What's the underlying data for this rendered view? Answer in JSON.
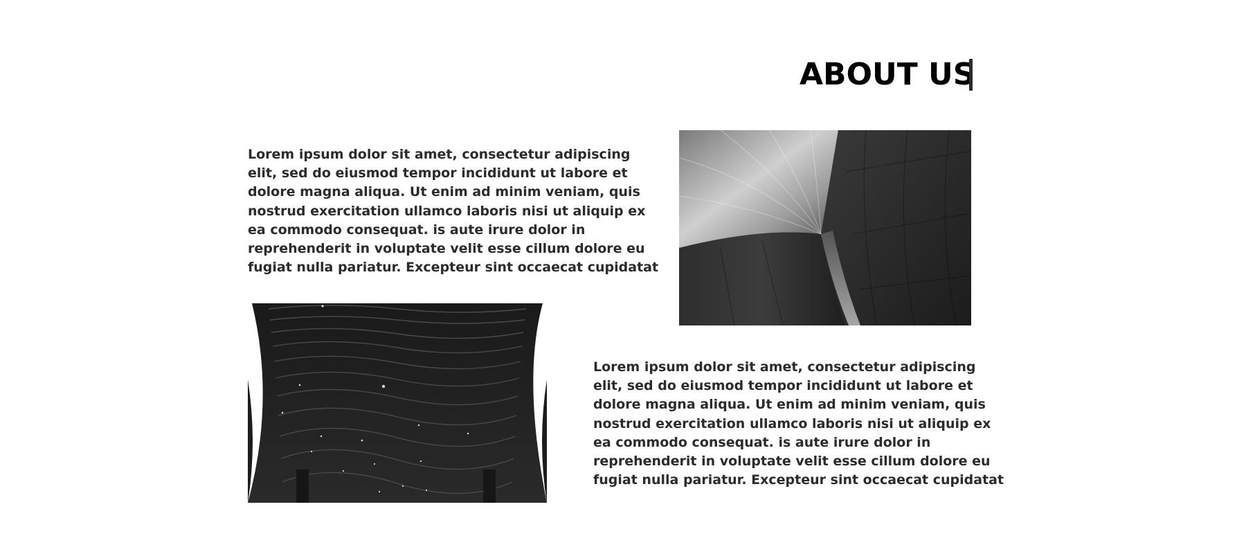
{
  "section": {
    "title": "ABOUT US"
  },
  "blocks": [
    {
      "text": "Lorem ipsum dolor sit amet, consectetur adipiscing elit, sed do eiusmod tempor incididunt ut labore et dolore magna aliqua. Ut enim ad minim veniam, quis nostrud exercitation ullamco laboris nisi ut aliquip ex ea commodo consequat. is aute irure dolor in reprehenderit in voluptate velit esse cillum dolore eu fugiat nulla pariatur. Excepteur sint occaecat cupidatat"
    },
    {
      "text": "Lorem ipsum dolor sit amet, consectetur adipiscing elit, sed do eiusmod tempor incididunt ut labore et dolore magna aliqua. Ut enim ad minim veniam, quis nostrud exercitation ullamco laboris nisi ut aliquip ex ea commodo consequat. is aute irure dolor in reprehenderit in voluptate velit esse cillum dolore eu fugiat nulla pariatur. Excepteur sint occaecat cupidatat"
    }
  ],
  "colors": {
    "background": "#ffffff",
    "heading": "#000000",
    "text": "#2b2b2b",
    "accent_bar": "#2b2b2b"
  }
}
